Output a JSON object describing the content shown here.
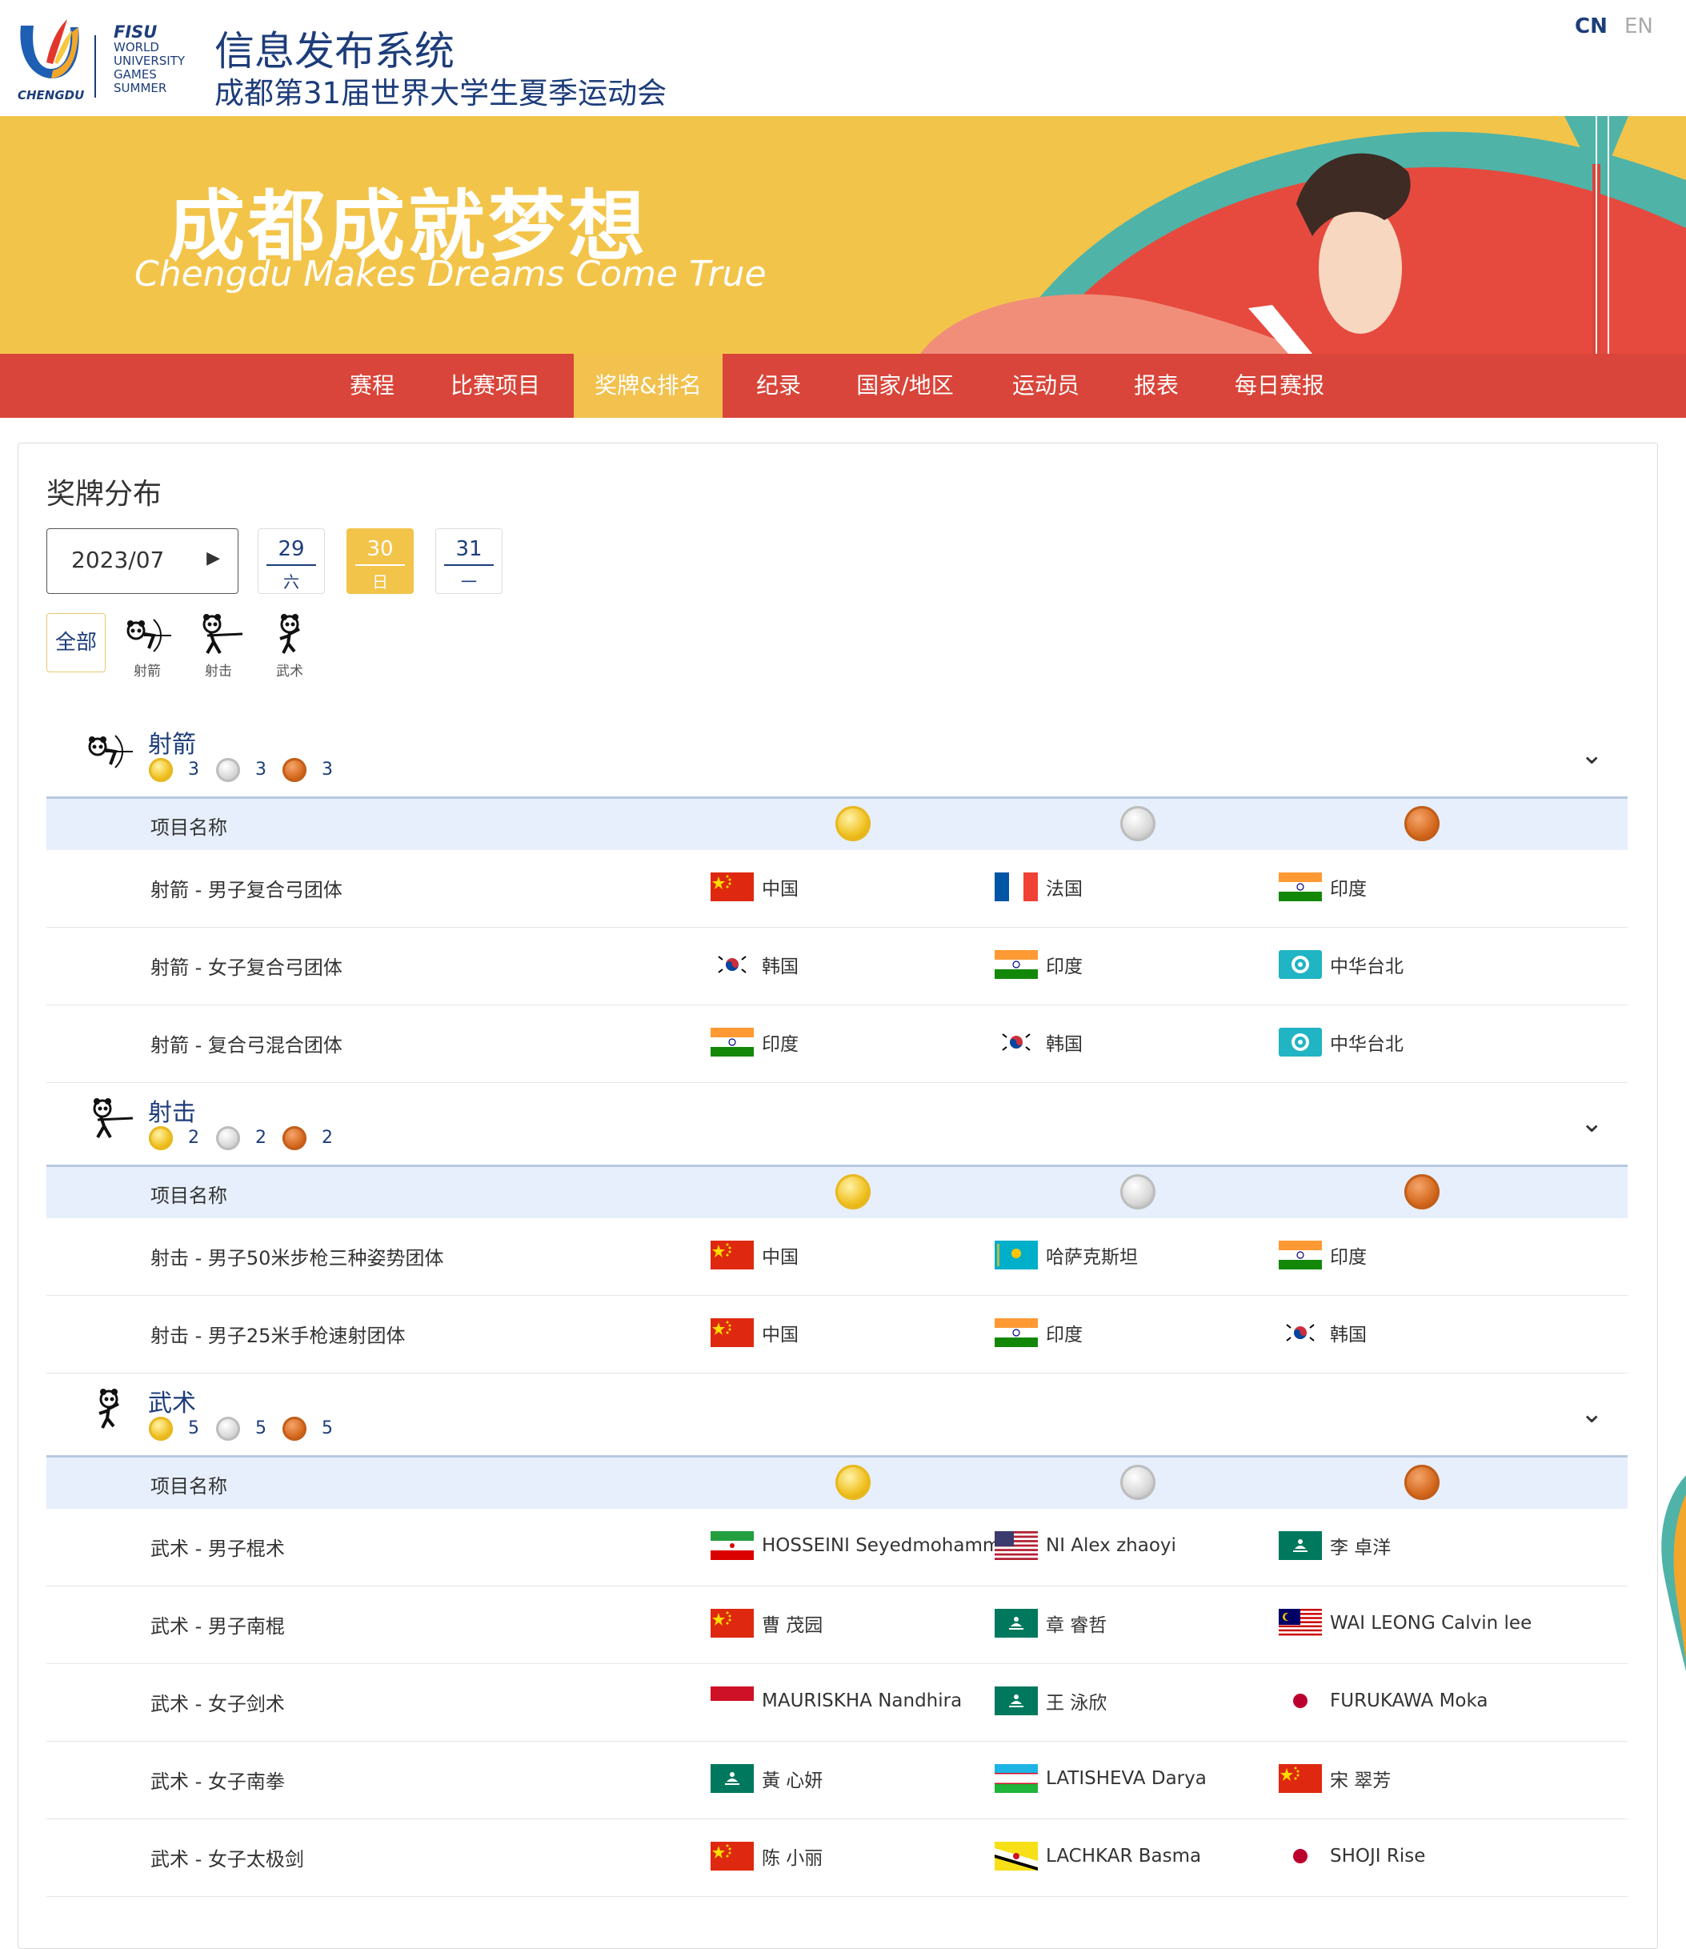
{
  "header": {
    "logo_city": "CHENGDU",
    "logo_fisu": "FISU",
    "logo_lines": [
      "WORLD",
      "UNIVERSITY",
      "GAMES",
      "SUMMER"
    ],
    "title": "信息发布系统",
    "subtitle": "成都第31届世界大学生夏季运动会",
    "lang_cn": "CN",
    "lang_en": "EN"
  },
  "banner": {
    "title": "成都成就梦想",
    "subtitle": "Chengdu Makes Dreams Come True"
  },
  "nav": {
    "items": [
      "赛程",
      "比赛项目",
      "奖牌&排名",
      "纪录",
      "国家/地区",
      "运动员",
      "报表",
      "每日赛报"
    ],
    "active": "奖牌&排名"
  },
  "main": {
    "title": "奖牌分布",
    "month": "2023/07",
    "days": [
      {
        "d": "29",
        "w": "六",
        "active": false
      },
      {
        "d": "30",
        "w": "日",
        "active": true
      },
      {
        "d": "31",
        "w": "一",
        "active": false
      }
    ],
    "filter_all": "全部",
    "filter_sports": [
      "射箭",
      "射击",
      "武术"
    ],
    "table_header": "项目名称"
  },
  "sports": [
    {
      "name": "射箭",
      "gold": "3",
      "silver": "3",
      "bronze": "3",
      "rows": [
        {
          "event": "射箭 - 男子复合弓团体",
          "gold": {
            "flag": "cn",
            "name": "中国"
          },
          "silver": {
            "flag": "fr",
            "name": "法国"
          },
          "bronze": {
            "flag": "in",
            "name": "印度"
          }
        },
        {
          "event": "射箭 - 女子复合弓团体",
          "gold": {
            "flag": "kr",
            "name": "韩国"
          },
          "silver": {
            "flag": "in",
            "name": "印度"
          },
          "bronze": {
            "flag": "tpe",
            "name": "中华台北"
          }
        },
        {
          "event": "射箭 - 复合弓混合团体",
          "gold": {
            "flag": "in",
            "name": "印度"
          },
          "silver": {
            "flag": "kr",
            "name": "韩国"
          },
          "bronze": {
            "flag": "tpe",
            "name": "中华台北"
          }
        }
      ]
    },
    {
      "name": "射击",
      "gold": "2",
      "silver": "2",
      "bronze": "2",
      "rows": [
        {
          "event": "射击 - 男子50米步枪三种姿势团体",
          "gold": {
            "flag": "cn",
            "name": "中国"
          },
          "silver": {
            "flag": "kz",
            "name": "哈萨克斯坦"
          },
          "bronze": {
            "flag": "in",
            "name": "印度"
          }
        },
        {
          "event": "射击 - 男子25米手枪速射团体",
          "gold": {
            "flag": "cn",
            "name": "中国"
          },
          "silver": {
            "flag": "in",
            "name": "印度"
          },
          "bronze": {
            "flag": "kr",
            "name": "韩国"
          }
        }
      ]
    },
    {
      "name": "武术",
      "gold": "5",
      "silver": "5",
      "bronze": "5",
      "rows": [
        {
          "event": "武术 - 男子棍术",
          "gold": {
            "flag": "ir",
            "name": "HOSSEINI Seyedmohammad"
          },
          "silver": {
            "flag": "us",
            "name": "NI Alex zhaoyi"
          },
          "bronze": {
            "flag": "mo",
            "name": "李 卓洋"
          }
        },
        {
          "event": "武术 - 男子南棍",
          "gold": {
            "flag": "cn",
            "name": "曹 茂园"
          },
          "silver": {
            "flag": "mo",
            "name": "章 睿哲"
          },
          "bronze": {
            "flag": "my",
            "name": "WAI LEONG Calvin lee"
          }
        },
        {
          "event": "武术 - 女子剑术",
          "gold": {
            "flag": "id",
            "name": "MAURISKHA Nandhira"
          },
          "silver": {
            "flag": "mo",
            "name": "王 泳欣"
          },
          "bronze": {
            "flag": "jp",
            "name": "FURUKAWA Moka"
          }
        },
        {
          "event": "武术 - 女子南拳",
          "gold": {
            "flag": "mo",
            "name": "黃 心妍"
          },
          "silver": {
            "flag": "uz",
            "name": "LATISHEVA Darya"
          },
          "bronze": {
            "flag": "cn",
            "name": "宋 翠芳"
          }
        },
        {
          "event": "武术 - 女子太极剑",
          "gold": {
            "flag": "cn",
            "name": "陈 小丽"
          },
          "silver": {
            "flag": "bn",
            "name": "LACHKAR Basma"
          },
          "bronze": {
            "flag": "jp",
            "name": "SHOJI Rise"
          }
        }
      ]
    }
  ],
  "colors": {
    "brand_blue": "#1d3d7a",
    "nav_red": "#d9453a",
    "nav_active": "#f2c14e",
    "banner_yellow": "#f3c44a",
    "header_row": "#e6effb"
  }
}
